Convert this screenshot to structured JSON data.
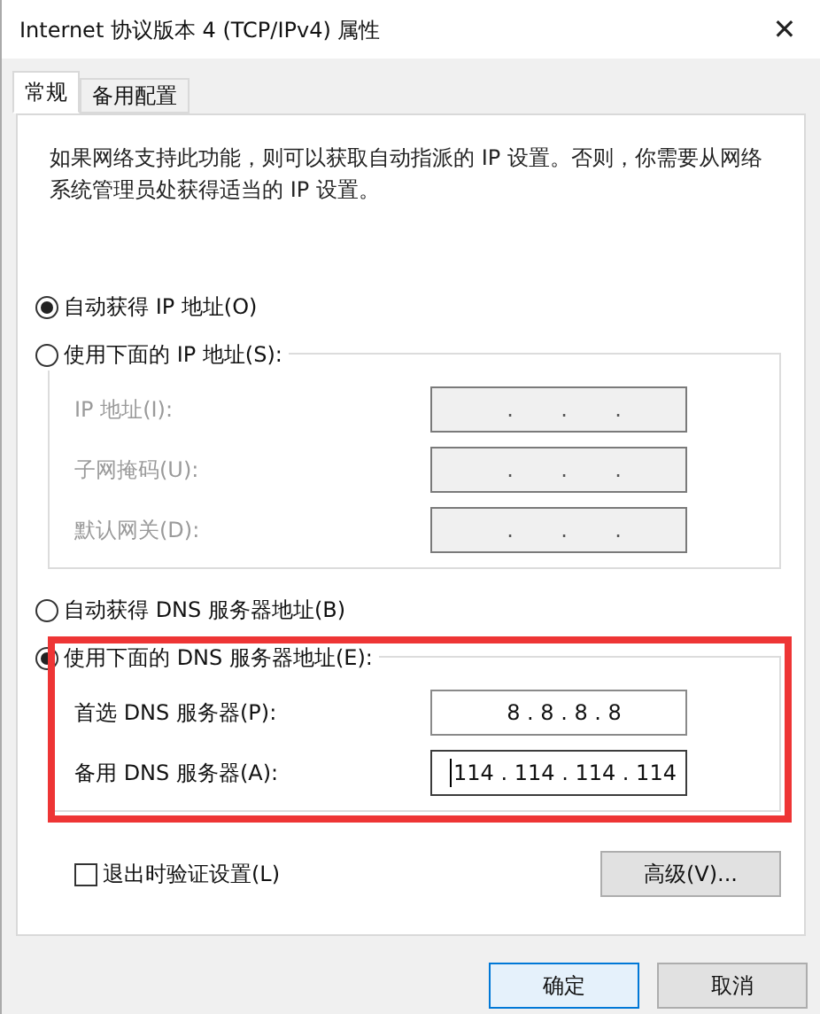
{
  "window": {
    "title": "Internet 协议版本 4 (TCP/IPv4) 属性",
    "close": "✕"
  },
  "tabs": [
    {
      "label": "常规",
      "selected": true
    },
    {
      "label": "备用配置",
      "selected": false
    }
  ],
  "description": "如果网络支持此功能，则可以获取自动指派的 IP 设置。否则，你需要从网络系统管理员处获得适当的 IP 设置。",
  "ip_section": {
    "options": [
      {
        "label": "自动获得 IP 地址(O)",
        "selected": true
      },
      {
        "label": "使用下面的 IP 地址(S):",
        "selected": false
      }
    ],
    "disabled": true,
    "fields": [
      {
        "label": "IP 地址(I):",
        "value": "      .       .       .      ",
        "focused": false
      },
      {
        "label": "子网掩码(U):",
        "value": "      .       .       .      ",
        "focused": false
      },
      {
        "label": "默认网关(D):",
        "value": "      .       .       .      ",
        "focused": false
      }
    ]
  },
  "dns_section": {
    "options": [
      {
        "label": "自动获得 DNS 服务器地址(B)",
        "selected": false
      },
      {
        "label": "使用下面的 DNS 服务器地址(E):",
        "selected": true
      }
    ],
    "disabled": false,
    "fields": [
      {
        "label": "首选 DNS 服务器(P):",
        "value": "8 . 8 . 8 . 8",
        "focused": false
      },
      {
        "label": "备用 DNS 服务器(A):",
        "value": "114 . 114 . 114 . 114",
        "focused": true
      }
    ]
  },
  "highlight": true,
  "validate_checkbox": {
    "label": "退出时验证设置(L)",
    "checked": false
  },
  "advanced_button": "高级(V)...",
  "buttons": [
    {
      "label": "确定",
      "default": true
    },
    {
      "label": "取消",
      "default": false
    }
  ]
}
